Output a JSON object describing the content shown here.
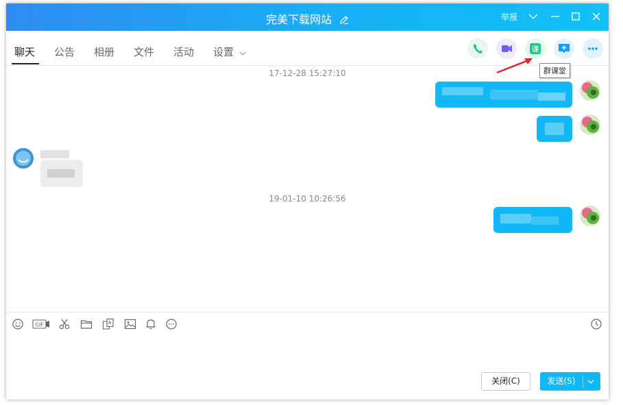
{
  "window": {
    "title": "完美下载网站",
    "report": "举报"
  },
  "tabs": [
    {
      "label": "聊天"
    },
    {
      "label": "公告"
    },
    {
      "label": "相册"
    },
    {
      "label": "文件"
    },
    {
      "label": "活动"
    },
    {
      "label": "设置"
    }
  ],
  "toolbar": {
    "tooltip": "群课堂",
    "course_icon_label": "课"
  },
  "chat": {
    "timestamps": [
      "17-12-28 15:27:10",
      "19-01-10 10:26:56"
    ]
  },
  "buttons": {
    "close": "关闭(C)",
    "send": "发送(S)"
  },
  "colors": {
    "accent": "#12b7f5",
    "title_gradient_start": "#2e8cf3",
    "title_gradient_end": "#12c0f7"
  },
  "icons": [
    "edit-icon",
    "chevron-down-icon",
    "minimize-icon",
    "maximize-icon",
    "close-icon",
    "phone-icon",
    "video-icon",
    "course-icon",
    "share-screen-icon",
    "more-icon",
    "emoji-icon",
    "gif-icon",
    "scissors-icon",
    "folder-icon",
    "sticker-icon",
    "image-icon",
    "bell-icon",
    "more-circle-icon",
    "history-clock-icon"
  ]
}
